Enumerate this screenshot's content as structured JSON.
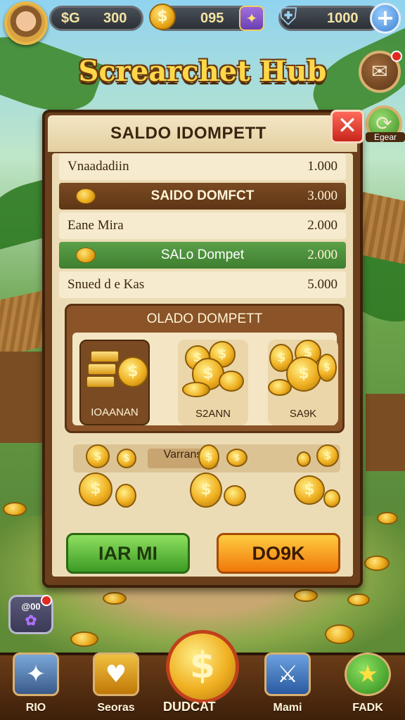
{
  "topbar": {
    "gold_symbol": "$G",
    "gold_amount": "300",
    "coins_amount": "095",
    "shield_amount": "1000"
  },
  "hub": {
    "title": "Screarchet Hub"
  },
  "corner": {
    "side_label": "Egear"
  },
  "panel": {
    "title": "SALDO IDOMPETT",
    "rows": [
      {
        "label": "Vnaadadiin",
        "value": "1.000",
        "style": "plain"
      },
      {
        "label": "SAIDO DOMFCT",
        "value": "3.000",
        "style": "brown"
      },
      {
        "label": "Eane Mira",
        "value": "2.000",
        "style": "plain"
      },
      {
        "label": "SALo Dompet",
        "value": "2.000",
        "style": "green"
      },
      {
        "label": "Snued d e Kas",
        "value": "5.000",
        "style": "plain"
      }
    ],
    "section_title": "OLADO DOMPETT",
    "cards": [
      {
        "label": "IOAANAN",
        "selected": true
      },
      {
        "label": "S2ANN",
        "selected": false
      },
      {
        "label": "SA9K",
        "selected": false
      }
    ],
    "varans_label": "Varrans",
    "button_left": "IAR MI",
    "button_right": "DO9K"
  },
  "float_left": {
    "label": "@00"
  },
  "nav": {
    "items": [
      {
        "label": "RIO",
        "icon": "star-shield-icon"
      },
      {
        "label": "Seoras",
        "icon": "gift-icon"
      },
      {
        "label": "DUDCAT",
        "icon": "coin-icon"
      },
      {
        "label": "Mami",
        "icon": "sword-icon"
      },
      {
        "label": "FADK",
        "icon": "star-icon"
      }
    ]
  },
  "colors": {
    "gold": "#f0b022",
    "panel_brown": "#6b3f1c",
    "green_button": "#3c9a24",
    "orange_button": "#f0780a"
  }
}
